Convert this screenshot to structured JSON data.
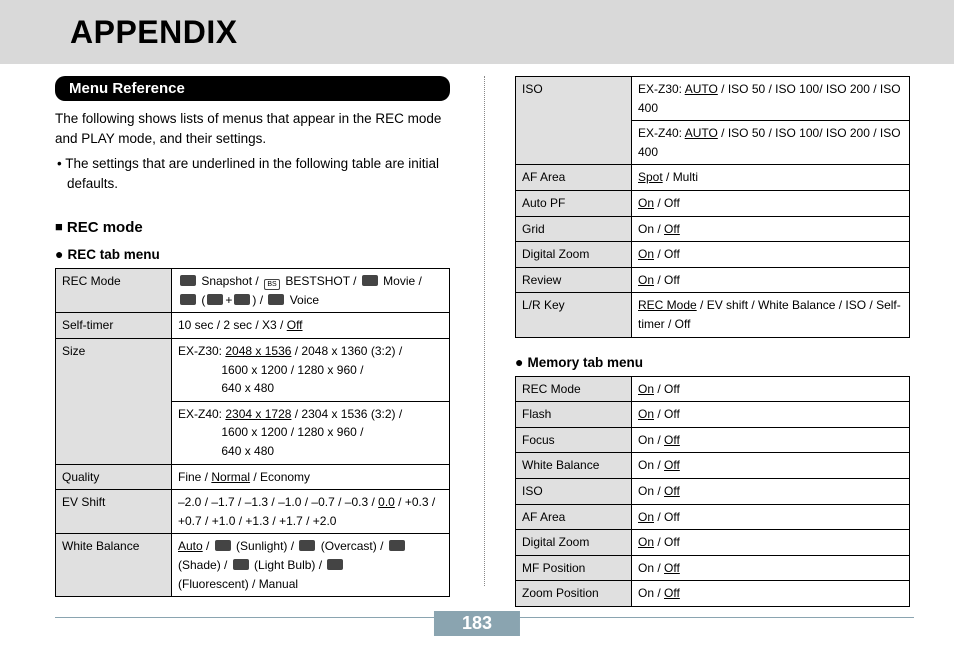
{
  "title": "APPENDIX",
  "section_label": "Menu Reference",
  "intro": "The following shows lists of menus that appear in the REC mode and PLAY mode, and their settings.",
  "bullet": "• The settings that are underlined in the following table are initial defaults.",
  "rec_mode_heading": "REC mode",
  "rec_tab_heading": "REC tab menu",
  "memory_tab_heading": "Memory tab menu",
  "page_number": "183",
  "rec_tab": {
    "rec_mode_label": "REC Mode",
    "rec_mode_val_a": " Snapshot / ",
    "rec_mode_val_bs": " BESTSHOT / ",
    "rec_mode_val_mv": " Movie / ",
    "rec_mode_val_voice": " Voice",
    "self_timer_label": "Self-timer",
    "self_timer_val": "10 sec / 2 sec / X3 / ",
    "self_timer_def": "Off",
    "size_label": "Size",
    "size_z30_prefix": "EX-Z30: ",
    "size_z30_def": "2048 x 1536",
    "size_z30_rest1": " / 2048 x 1360 (3:2) /",
    "size_z30_rest2": "1600 x 1200 / 1280 x 960 /",
    "size_z30_rest3": "640 x 480",
    "size_z40_prefix": "EX-Z40: ",
    "size_z40_def": "2304 x 1728",
    "size_z40_rest1": " / 2304 x 1536 (3:2) /",
    "size_z40_rest2": "1600 x 1200 / 1280 x 960 /",
    "size_z40_rest3": "640 x 480",
    "quality_label": "Quality",
    "quality_pre": "Fine / ",
    "quality_def": "Normal",
    "quality_post": " / Economy",
    "ev_label": "EV Shift",
    "ev_pre": "–2.0 / –1.7 / –1.3 / –1.0 / –0.7 / –0.3 / ",
    "ev_def": "0.0",
    "ev_post": " / +0.3 / +0.7 / +1.0 / +1.3 / +1.7 / +2.0",
    "wb_label": "White Balance",
    "wb_auto": "Auto",
    "wb_sun": " (Sunlight) / ",
    "wb_over": " (Overcast) / ",
    "wb_shade_pre": "(Shade) / ",
    "wb_bulb": " (Light Bulb) / ",
    "wb_fluo": "(Fluorescent) / Manual"
  },
  "right_tab": {
    "iso_label": "ISO",
    "iso_z30_pre": "EX-Z30: ",
    "iso_def": "AUTO",
    "iso_rest": " / ISO 50 / ISO 100/ ISO 200 / ISO 400",
    "iso_z40_pre": "EX-Z40: ",
    "af_area_label": "AF Area",
    "af_area_def": "Spot",
    "af_area_post": " / Multi",
    "auto_pf_label": "Auto PF",
    "on": "On",
    "off": "Off",
    "grid_label": "Grid",
    "dz_label": "Digital Zoom",
    "review_label": "Review",
    "lr_label": "L/R Key",
    "lr_def": "REC Mode",
    "lr_rest": " / EV shift / White Balance / ISO / Self-timer / Off"
  },
  "mem_tab": {
    "rec_mode": "REC Mode",
    "flash": "Flash",
    "focus": "Focus",
    "wb": "White Balance",
    "iso": "ISO",
    "af": "AF Area",
    "dz": "Digital Zoom",
    "mf": "MF Position",
    "zoom": "Zoom Position"
  }
}
